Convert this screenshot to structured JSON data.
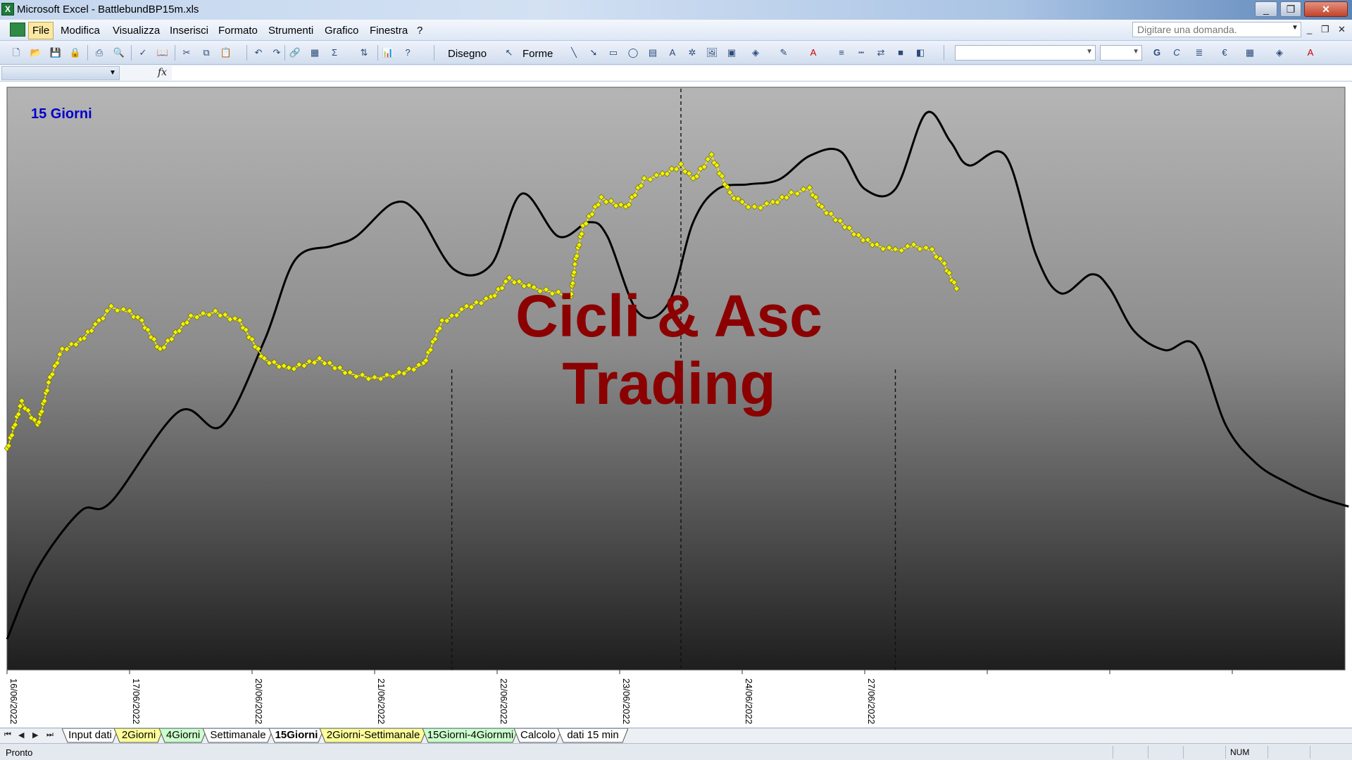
{
  "window": {
    "title": "Microsoft Excel - BattlebundBP15m.xls",
    "app_icon": "excel-icon",
    "buttons": [
      "_",
      "❐",
      "✕"
    ]
  },
  "menu": {
    "items": [
      "File",
      "Modifica",
      "Visualizza",
      "Inserisci",
      "Formato",
      "Strumenti",
      "Grafico",
      "Finestra",
      "?"
    ],
    "ask_placeholder": "Digitare una domanda.",
    "mdi_buttons": [
      "_",
      "❐",
      "✕"
    ]
  },
  "toolbar": {
    "disegno_label": "Disegno",
    "forme_label": "Forme",
    "sigma": "Σ",
    "bold": "G",
    "italic": "C",
    "euro": "€"
  },
  "formula_bar": {
    "fx": "fx"
  },
  "chart_data": {
    "type": "line",
    "title": "15 Giorni",
    "watermark_line1": "Cicli & Asc",
    "watermark_line2": "Trading",
    "x_tick_labels": [
      "16/06/2022",
      "17/06/2022",
      "20/06/2022",
      "21/06/2022",
      "22/06/2022",
      "23/06/2022",
      "24/06/2022",
      "27/06/2022"
    ],
    "grid": false,
    "background": "gray gradient",
    "colors": {
      "price": "#f2f20a",
      "price_marker_stroke": "#6b6b00",
      "cycle": "#000000",
      "title": "#0000cc",
      "watermark": "#8b0000"
    },
    "dashed_vertical_markers": [
      3.63,
      5.5,
      7.25
    ],
    "series": [
      {
        "style": "yellow line with diamond markers",
        "x": [
          0,
          0.12,
          0.25,
          0.35,
          0.45,
          0.6,
          0.75,
          0.85,
          1.0,
          1.1,
          1.25,
          1.5,
          1.7,
          1.9,
          2.1,
          2.3,
          2.55,
          2.8,
          3.0,
          3.2,
          3.4,
          3.55,
          3.63,
          3.75,
          3.95,
          4.1,
          4.3,
          4.5,
          4.6,
          4.64,
          4.7,
          4.85,
          5.05,
          5.2,
          5.35,
          5.5,
          5.6,
          5.75,
          5.9,
          6.0,
          6.1,
          6.25,
          6.4,
          6.55,
          6.65,
          6.8,
          6.95,
          7.1,
          7.25,
          7.4,
          7.55,
          7.65,
          7.75
        ],
        "y": [
          0.45,
          0.55,
          0.5,
          0.6,
          0.66,
          0.68,
          0.72,
          0.75,
          0.74,
          0.72,
          0.66,
          0.73,
          0.74,
          0.72,
          0.64,
          0.62,
          0.64,
          0.61,
          0.6,
          0.61,
          0.63,
          0.72,
          0.73,
          0.75,
          0.77,
          0.81,
          0.79,
          0.78,
          0.77,
          0.85,
          0.92,
          0.98,
          0.96,
          1.02,
          1.03,
          1.05,
          1.02,
          1.07,
          0.99,
          0.97,
          0.96,
          0.97,
          0.99,
          1.0,
          0.96,
          0.93,
          0.9,
          0.88,
          0.87,
          0.88,
          0.87,
          0.84,
          0.79
        ]
      },
      {
        "style": "black smooth cycle line",
        "x": [
          0,
          0.25,
          0.6,
          0.85,
          1.4,
          1.75,
          2.1,
          2.35,
          2.65,
          2.85,
          3.15,
          3.35,
          3.65,
          3.95,
          4.2,
          4.5,
          4.75,
          4.9,
          5.15,
          5.4,
          5.6,
          5.8,
          6.05,
          6.3,
          6.55,
          6.8,
          7.0,
          7.25,
          7.5,
          7.7,
          7.85,
          8.15,
          8.4,
          8.6,
          8.85,
          9.0,
          9.2,
          9.45,
          9.7,
          9.95,
          10.2,
          10.45,
          10.7,
          10.95
        ],
        "y": [
          0.05,
          0.2,
          0.32,
          0.34,
          0.53,
          0.5,
          0.68,
          0.85,
          0.88,
          0.9,
          0.97,
          0.95,
          0.83,
          0.84,
          0.99,
          0.9,
          0.93,
          0.9,
          0.74,
          0.76,
          0.93,
          1.0,
          1.01,
          1.02,
          1.07,
          1.08,
          1.0,
          1.0,
          1.16,
          1.1,
          1.05,
          1.07,
          0.86,
          0.78,
          0.82,
          0.79,
          0.7,
          0.66,
          0.67,
          0.5,
          0.42,
          0.38,
          0.35,
          0.33
        ]
      }
    ]
  },
  "sheet_tabs": [
    {
      "label": "Input dati",
      "color": "#ffffff",
      "active": false
    },
    {
      "label": "2Giorni",
      "color": "#ffff99",
      "active": false
    },
    {
      "label": "4Giorni",
      "color": "#ccffcc",
      "active": false
    },
    {
      "label": "Settimanale",
      "color": "#ffffff",
      "active": false
    },
    {
      "label": "15Giorni",
      "color": "#ffffff",
      "active": true
    },
    {
      "label": "2Giorni-Settimanale",
      "color": "#ffff99",
      "active": false
    },
    {
      "label": "15Giorni-4Giornmi",
      "color": "#ccffcc",
      "active": false
    },
    {
      "label": "Calcolo",
      "color": "#ffffff",
      "active": false
    },
    {
      "label": "dati 15 min",
      "color": "#ffffff",
      "active": false
    }
  ],
  "status": {
    "text": "Pronto",
    "num": "NUM"
  }
}
